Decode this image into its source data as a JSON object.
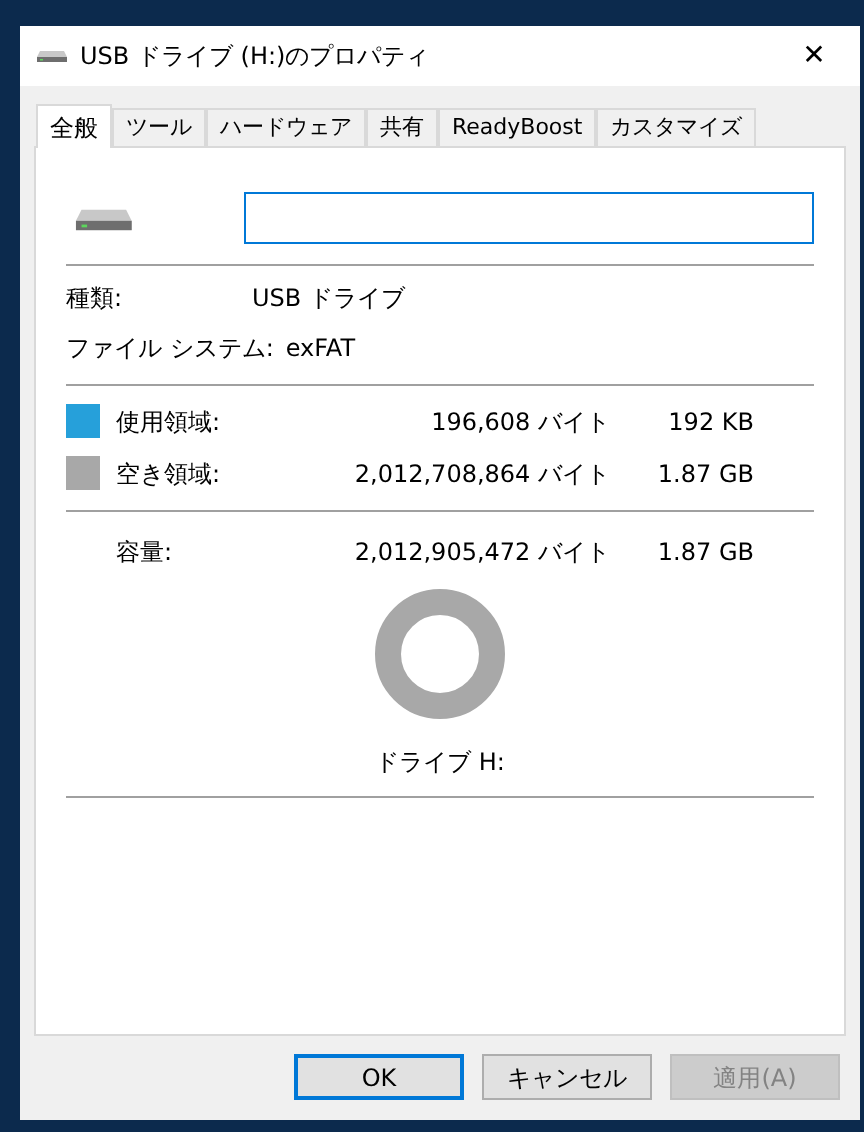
{
  "window": {
    "title": "USB ドライブ (H:)のプロパティ",
    "close": "✕"
  },
  "tabs": [
    {
      "label": "全般",
      "selected": true
    },
    {
      "label": "ツール",
      "selected": false
    },
    {
      "label": "ハードウェア",
      "selected": false
    },
    {
      "label": "共有",
      "selected": false
    },
    {
      "label": "ReadyBoost",
      "selected": false
    },
    {
      "label": "カスタマイズ",
      "selected": false
    }
  ],
  "info": [
    {
      "label": "種類:",
      "value": "USB ドライブ"
    },
    {
      "label": "ファイル システム:",
      "value": "exFAT"
    }
  ],
  "space": [
    {
      "label": "使用領域:",
      "bytes": "196,608 バイト",
      "size": "192 KB",
      "color": "#26a0da"
    },
    {
      "label": "空き領域:",
      "bytes": "2,012,708,864 バイト",
      "size": "1.87 GB",
      "color": "#a8a8a8"
    }
  ],
  "capacity": {
    "label": "容量:",
    "bytes": "2,012,905,472 バイト",
    "size": "1.87 GB"
  },
  "drive_label": "ドライブ H:",
  "buttons": [
    {
      "label": "OK",
      "kind": "default",
      "disabled": false
    },
    {
      "label": "キャンセル",
      "kind": "normal",
      "disabled": false
    },
    {
      "label": "適用(A)",
      "kind": "normal",
      "disabled": true
    }
  ]
}
